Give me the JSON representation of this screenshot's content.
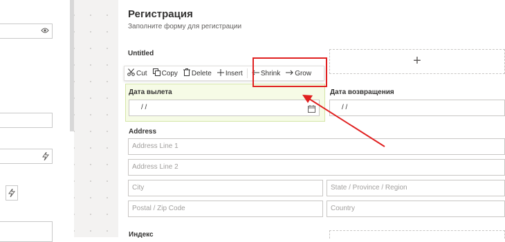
{
  "form": {
    "title": "Регистрация",
    "subtitle": "Заполните форму для регистрации"
  },
  "untitled_label": "Untitled",
  "toolbar": {
    "cut": "Cut",
    "copy": "Copy",
    "delete": "Delete",
    "insert": "Insert",
    "shrink": "Shrink",
    "grow": "Grow"
  },
  "departure": {
    "label": "Дата вылета",
    "value": "/    /"
  },
  "return_date": {
    "label": "Дата возвращения",
    "value": "/    /"
  },
  "address": {
    "label": "Address",
    "line1_placeholder": "Address Line 1",
    "line2_placeholder": "Address Line 2",
    "city_placeholder": "City",
    "state_placeholder": "State / Province / Region",
    "zip_placeholder": "Postal / Zip Code",
    "country_placeholder": "Country"
  },
  "index_label": "Индекс",
  "add_symbol": "+",
  "icons": {
    "eye": "eye-icon",
    "bolt": "lightning-icon",
    "calendar": "calendar-icon",
    "scissors": "scissors-icon",
    "copy": "copy-icon",
    "trash": "trash-icon",
    "plus": "plus-icon",
    "arrow_left": "arrow-left-icon",
    "arrow_right": "arrow-right-icon"
  },
  "colors": {
    "highlight_red": "#e02020",
    "selected_bg": "#f6fbe6",
    "canvas_bg": "#f3f2f1"
  }
}
